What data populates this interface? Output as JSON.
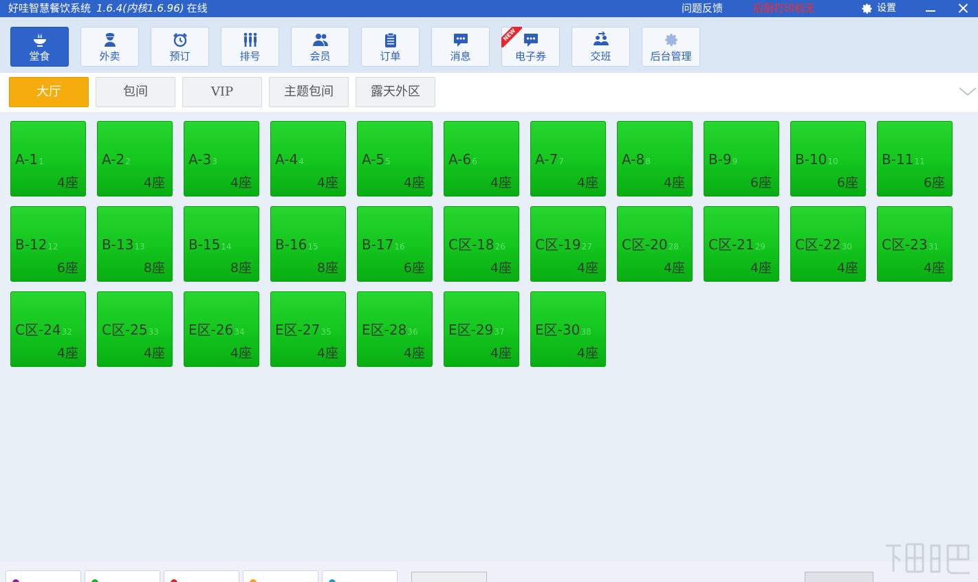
{
  "titlebar": {
    "app_name": "好哇智慧餐饮系统",
    "version": "1.6.4(内核1.6.96)",
    "status": "在线",
    "feedback": "问题反馈",
    "printer_status": "后厨打印机无",
    "settings": "设置"
  },
  "toolbar": {
    "items": [
      {
        "label": "堂食",
        "icon": "dine-in-icon",
        "active": true
      },
      {
        "label": "外卖",
        "icon": "delivery-icon"
      },
      {
        "label": "预订",
        "icon": "alarm-clock-icon"
      },
      {
        "label": "排号",
        "icon": "queue-icon"
      },
      {
        "label": "会员",
        "icon": "members-icon"
      },
      {
        "label": "订单",
        "icon": "clipboard-icon"
      },
      {
        "label": "消息",
        "icon": "message-icon"
      },
      {
        "label": "电子券",
        "icon": "coupon-icon",
        "badge": "NEW"
      },
      {
        "label": "交班",
        "icon": "shift-change-icon"
      },
      {
        "label": "后台管理",
        "icon": "gear-icon"
      }
    ]
  },
  "areas": {
    "tabs": [
      "大厅",
      "包间",
      "VIP",
      "主题包间",
      "露天外区"
    ],
    "active_index": 0
  },
  "tables": [
    {
      "name": "A-1",
      "num": "1",
      "seats": "4座"
    },
    {
      "name": "A-2",
      "num": "2",
      "seats": "4座"
    },
    {
      "name": "A-3",
      "num": "3",
      "seats": "4座"
    },
    {
      "name": "A-4",
      "num": "4",
      "seats": "4座"
    },
    {
      "name": "A-5",
      "num": "5",
      "seats": "4座"
    },
    {
      "name": "A-6",
      "num": "6",
      "seats": "4座"
    },
    {
      "name": "A-7",
      "num": "7",
      "seats": "4座"
    },
    {
      "name": "A-8",
      "num": "8",
      "seats": "4座"
    },
    {
      "name": "B-9",
      "num": "9",
      "seats": "6座"
    },
    {
      "name": "B-10",
      "num": "10",
      "seats": "6座"
    },
    {
      "name": "B-11",
      "num": "11",
      "seats": "6座"
    },
    {
      "name": "B-12",
      "num": "12",
      "seats": "6座"
    },
    {
      "name": "B-13",
      "num": "13",
      "seats": "8座"
    },
    {
      "name": "B-15",
      "num": "14",
      "seats": "8座"
    },
    {
      "name": "B-16",
      "num": "15",
      "seats": "8座"
    },
    {
      "name": "B-17",
      "num": "16",
      "seats": "6座"
    },
    {
      "name": "C区-18",
      "num": "26",
      "seats": "4座"
    },
    {
      "name": "C区-19",
      "num": "27",
      "seats": "4座"
    },
    {
      "name": "C区-20",
      "num": "28",
      "seats": "4座"
    },
    {
      "name": "C区-21",
      "num": "29",
      "seats": "4座"
    },
    {
      "name": "C区-22",
      "num": "30",
      "seats": "4座"
    },
    {
      "name": "C区-23",
      "num": "31",
      "seats": "4座"
    },
    {
      "name": "C区-24",
      "num": "32",
      "seats": "4座"
    },
    {
      "name": "C区-25",
      "num": "33",
      "seats": "4座"
    },
    {
      "name": "E区-26",
      "num": "34",
      "seats": "4座"
    },
    {
      "name": "E区-27",
      "num": "35",
      "seats": "4座"
    },
    {
      "name": "E区-28",
      "num": "36",
      "seats": "4座"
    },
    {
      "name": "E区-29",
      "num": "37",
      "seats": "4座"
    },
    {
      "name": "E区-30",
      "num": "38",
      "seats": "4座"
    }
  ],
  "legend": {
    "colors": [
      "#8a1f9c",
      "#18b32a",
      "#d42a2a",
      "#f0a020",
      "#1f9fc0"
    ]
  },
  "colors": {
    "brand_blue": "#2e63c9",
    "table_green": "#13c51d",
    "active_area": "#f5ad0e",
    "alert_red": "#ff2a2a"
  }
}
